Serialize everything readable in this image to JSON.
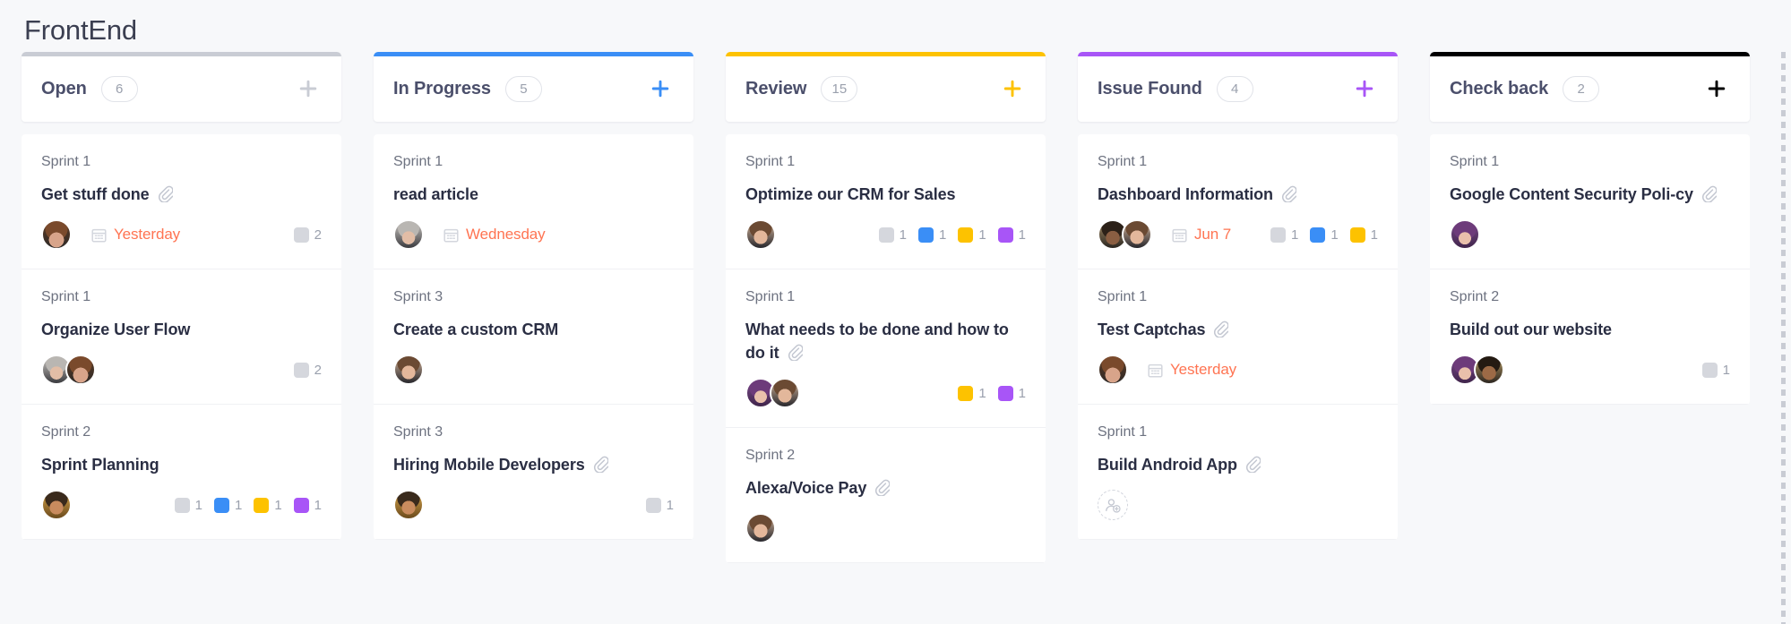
{
  "board": {
    "title": "FrontEnd"
  },
  "icons": {
    "add": "plus-icon",
    "attachment": "paperclip-icon",
    "due": "calendar-icon",
    "add_assignee": "add-person-icon"
  },
  "tag_colors": {
    "gray": "#d5d7dd",
    "blue": "#3a8ef6",
    "yellow": "#fdc200",
    "purple": "#a855f7"
  },
  "columns": [
    {
      "name": "Open",
      "count": "6",
      "accent": "#c9ccd4",
      "cards": [
        {
          "sprint": "Sprint 1",
          "title": "Get stuff done",
          "attachment": true,
          "avatars": [
            "av-a"
          ],
          "due": "Yesterday",
          "tags": [
            {
              "color": "gray",
              "count": "2"
            }
          ]
        },
        {
          "sprint": "Sprint 1",
          "title": "Organize User Flow",
          "attachment": false,
          "avatars": [
            "av-b",
            "av-a"
          ],
          "due": "",
          "tags": [
            {
              "color": "gray",
              "count": "2"
            }
          ]
        },
        {
          "sprint": "Sprint 2",
          "title": "Sprint Planning",
          "attachment": false,
          "avatars": [
            "av-f"
          ],
          "due": "",
          "tags": [
            {
              "color": "gray",
              "count": "1"
            },
            {
              "color": "blue",
              "count": "1"
            },
            {
              "color": "yellow",
              "count": "1"
            },
            {
              "color": "purple",
              "count": "1"
            }
          ]
        }
      ]
    },
    {
      "name": "In Progress",
      "count": "5",
      "accent": "#3a8ef6",
      "cards": [
        {
          "sprint": "Sprint 1",
          "title": "read article",
          "attachment": false,
          "avatars": [
            "av-b"
          ],
          "due": "Wednesday",
          "tags": []
        },
        {
          "sprint": "Sprint 3",
          "title": "Create a custom CRM",
          "attachment": false,
          "avatars": [
            "av-c"
          ],
          "due": "",
          "tags": []
        },
        {
          "sprint": "Sprint 3",
          "title": "Hiring Mobile Developers",
          "attachment": true,
          "avatars": [
            "av-f"
          ],
          "due": "",
          "tags": [
            {
              "color": "gray",
              "count": "1"
            }
          ]
        }
      ]
    },
    {
      "name": "Review",
      "count": "15",
      "accent": "#fdc200",
      "cards": [
        {
          "sprint": "Sprint 1",
          "title": "Optimize our CRM for Sales",
          "attachment": false,
          "avatars": [
            "av-c"
          ],
          "due": "",
          "tags": [
            {
              "color": "gray",
              "count": "1"
            },
            {
              "color": "blue",
              "count": "1"
            },
            {
              "color": "yellow",
              "count": "1"
            },
            {
              "color": "purple",
              "count": "1"
            }
          ]
        },
        {
          "sprint": "Sprint 1",
          "title": "What needs to be done and how to do it",
          "attachment": true,
          "avatars": [
            "av-e",
            "av-c"
          ],
          "due": "",
          "tags": [
            {
              "color": "yellow",
              "count": "1"
            },
            {
              "color": "purple",
              "count": "1"
            }
          ]
        },
        {
          "sprint": "Sprint 2",
          "title": "Alexa/Voice Pay",
          "attachment": true,
          "avatars": [
            "av-c"
          ],
          "due": "",
          "tags": []
        }
      ]
    },
    {
      "name": "Issue Found",
      "count": "4",
      "accent": "#a855f7",
      "cards": [
        {
          "sprint": "Sprint 1",
          "title": "Dashboard Information",
          "attachment": true,
          "avatars": [
            "av-d",
            "av-c"
          ],
          "due": "Jun 7",
          "tags": [
            {
              "color": "gray",
              "count": "1"
            },
            {
              "color": "blue",
              "count": "1"
            },
            {
              "color": "yellow",
              "count": "1"
            }
          ]
        },
        {
          "sprint": "Sprint 1",
          "title": "Test Captchas",
          "attachment": true,
          "avatars": [
            "av-a"
          ],
          "due": "Yesterday",
          "tags": []
        },
        {
          "sprint": "Sprint 1",
          "title": "Build Android App",
          "attachment": true,
          "avatars": [],
          "add_assignee": true,
          "due": "",
          "tags": []
        }
      ]
    },
    {
      "name": "Check back",
      "count": "2",
      "accent": "#000000",
      "cards": [
        {
          "sprint": "Sprint 1",
          "title": "Google Content Security Poli-cy",
          "attachment": true,
          "avatars": [
            "av-e"
          ],
          "due": "",
          "tags": []
        },
        {
          "sprint": "Sprint 2",
          "title": "Build out our website",
          "attachment": false,
          "avatars": [
            "av-e",
            "av-g"
          ],
          "due": "",
          "tags": [
            {
              "color": "gray",
              "count": "1"
            }
          ]
        }
      ]
    }
  ]
}
